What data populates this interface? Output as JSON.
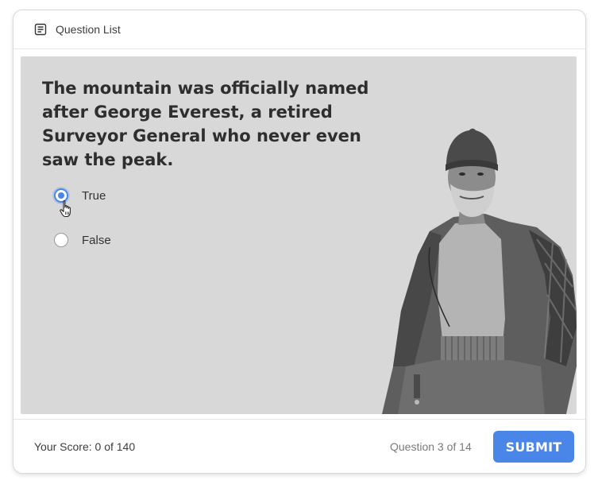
{
  "header": {
    "question_list_label": "Question List",
    "question_list_icon": "list-document-icon"
  },
  "question": {
    "text": "The mountain was officially named after George Everest, a retired Surveyor General who never even saw the peak.",
    "options": [
      {
        "label": "True",
        "selected": true
      },
      {
        "label": "False",
        "selected": false
      }
    ],
    "image_subject": "black-and-white photo of bearded mountaineer in knit cap and jacket"
  },
  "footer": {
    "score_text": "Your Score: 0 of 140",
    "progress_text": "Question 3 of 14",
    "submit_label": "SUBMIT"
  },
  "colors": {
    "accent": "#4a86e8",
    "stage_bg": "#d8d8d8"
  }
}
